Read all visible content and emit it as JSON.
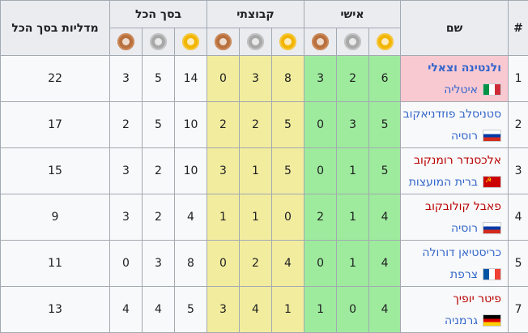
{
  "headers": {
    "rank": "#",
    "name": "שם",
    "individual": "אישי",
    "team": "קבוצתי",
    "overall": "בסך הכל",
    "total": "מדליות בסך הכל"
  },
  "medal_icons": [
    "gold-medal-icon",
    "silver-medal-icon",
    "bronze-medal-icon"
  ],
  "colors": {
    "individual_bg": "#9eeb9e",
    "team_bg": "#f2ec9e",
    "highlight_bg": "#f9c9d1",
    "link": "#3366cc",
    "redlink": "#ba0000"
  },
  "rows": [
    {
      "rank": "1",
      "athlete": "ולנטינה וצאלי",
      "country": "איטליה",
      "flag": "italy",
      "ind": [
        "6",
        "2",
        "3"
      ],
      "team": [
        "8",
        "3",
        "0"
      ],
      "overall": [
        "14",
        "5",
        "3"
      ],
      "total": "22"
    },
    {
      "rank": "2",
      "athlete": "סטניסלב פוזדניאקוב",
      "country": "רוסיה",
      "flag": "russia",
      "ind": [
        "5",
        "3",
        "0"
      ],
      "team": [
        "5",
        "2",
        "2"
      ],
      "overall": [
        "10",
        "5",
        "2"
      ],
      "total": "17"
    },
    {
      "rank": "3",
      "athlete": "אלכסנדר רומנקוב",
      "country": "ברית המועצות",
      "flag": "ussr",
      "ind": [
        "5",
        "1",
        "0"
      ],
      "team": [
        "5",
        "1",
        "3"
      ],
      "overall": [
        "10",
        "2",
        "3"
      ],
      "total": "15"
    },
    {
      "rank": "4",
      "athlete": "פאבל קולובקוב",
      "country": "רוסיה",
      "flag": "russia",
      "ind": [
        "4",
        "1",
        "2"
      ],
      "team": [
        "0",
        "1",
        "1"
      ],
      "overall": [
        "4",
        "2",
        "3"
      ],
      "total": "9"
    },
    {
      "rank": "5",
      "athlete": "כריסטיאן דורולה",
      "country": "צרפת",
      "flag": "france",
      "ind": [
        "4",
        "1",
        "0"
      ],
      "team": [
        "4",
        "2",
        "0"
      ],
      "overall": [
        "8",
        "3",
        "0"
      ],
      "total": "11"
    },
    {
      "rank": "7",
      "athlete": "פיטר יופיך",
      "country": "גרמניה",
      "flag": "germany",
      "ind": [
        "4",
        "0",
        "1"
      ],
      "team": [
        "1",
        "4",
        "3"
      ],
      "overall": [
        "5",
        "4",
        "4"
      ],
      "total": "13"
    }
  ]
}
